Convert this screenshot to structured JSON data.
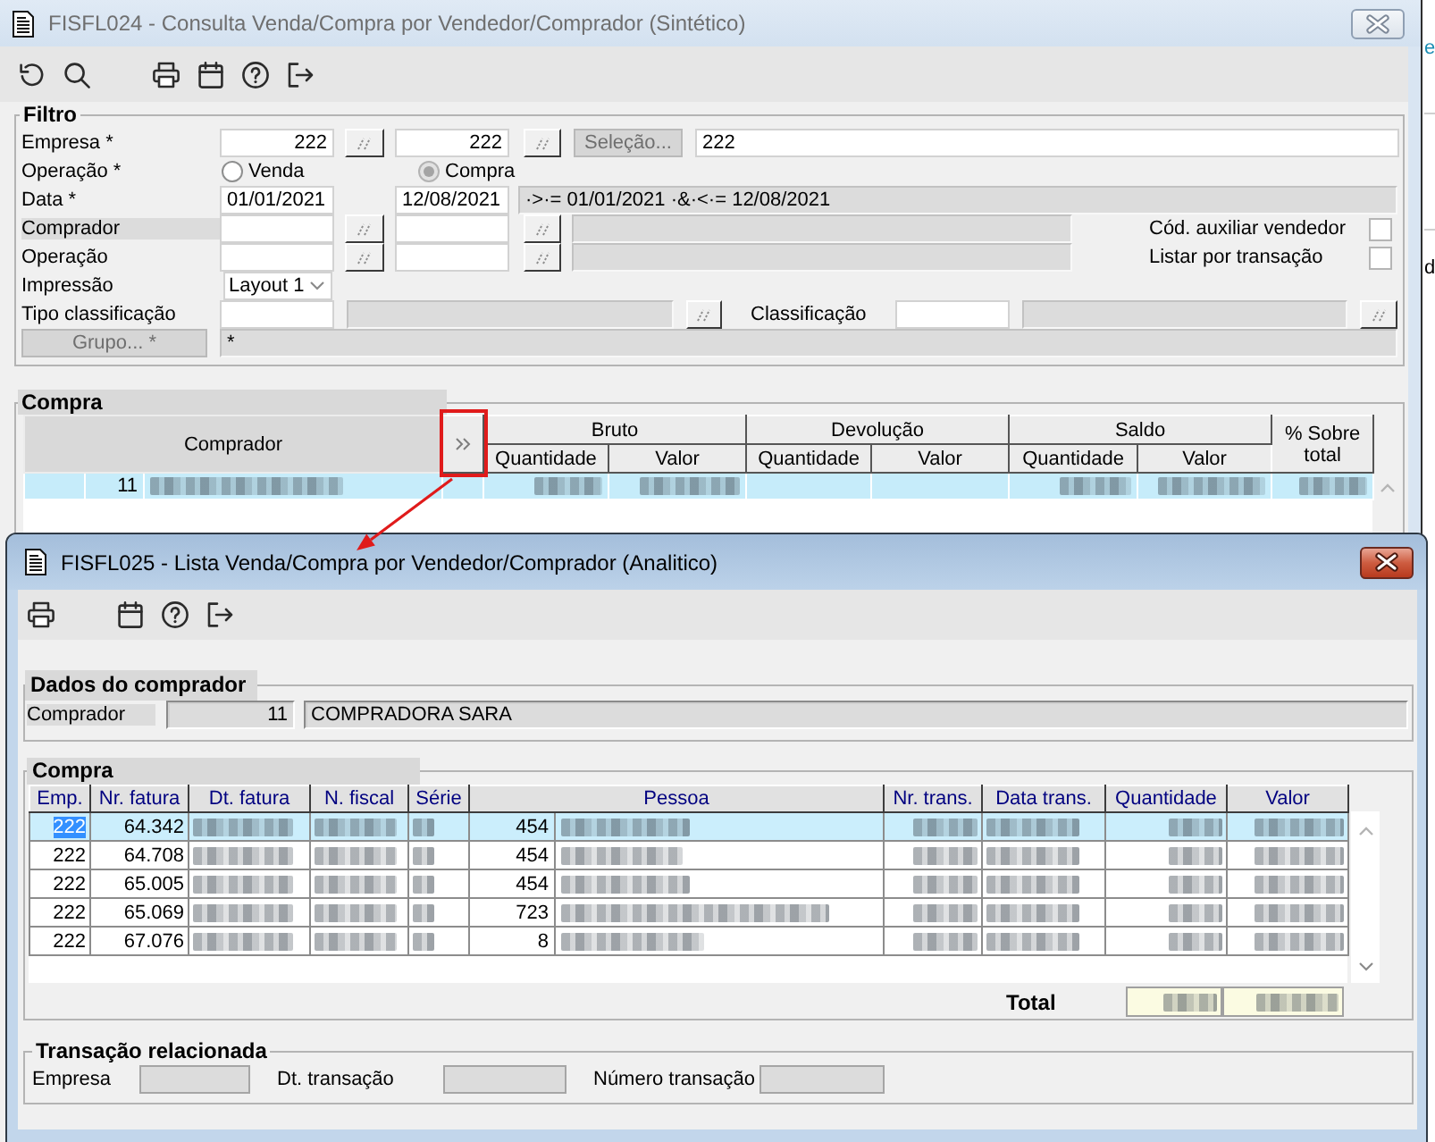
{
  "window": {
    "title": "FISFL024 - Consulta Venda/Compra por Vendedor/Comprador (Sintético)",
    "active": false
  },
  "filter": {
    "legend": "Filtro",
    "company": {
      "label": "Empresa *",
      "from": "222",
      "to": "222",
      "selection_button": {
        "label": "Seleção...",
        "disabled": true
      },
      "selection": "222"
    },
    "operation_type": {
      "label": "Operação *",
      "options": [
        {
          "label": "Venda",
          "selected": false
        },
        {
          "label": "Compra",
          "selected": true
        }
      ]
    },
    "date": {
      "label": "Data *",
      "from": "01/01/2021",
      "to": "12/08/2021",
      "expression": "·>·= 01/01/2021 ·&·<·= 12/08/2021"
    },
    "buyer": {
      "label": "Comprador",
      "highlighted": true
    },
    "operation": {
      "label": "Operação",
      "highlighted": false
    },
    "options": [
      {
        "label": "Cód. auxiliar vendedor",
        "checked": false
      },
      {
        "label": "Listar por transação",
        "checked": false
      }
    ],
    "print_layout": {
      "label": "Impressão",
      "value": "Layout 1"
    },
    "classification_type": {
      "label": "Tipo classificação"
    },
    "classification": {
      "label": "Classificação"
    },
    "group": {
      "button": {
        "label": "Grupo... *",
        "disabled": true
      },
      "value": "*"
    }
  },
  "summary": {
    "legend": "Compra",
    "columns": [
      {
        "kind": "label",
        "label": "Comprador",
        "highlighted": true
      },
      {
        "kind": "expand",
        "annotated": true
      },
      {
        "kind": "group",
        "label": "Bruto",
        "sub": [
          "Quantidade",
          "Valor"
        ]
      },
      {
        "kind": "group",
        "label": "Devolução",
        "sub": [
          "Quantidade",
          "Valor"
        ]
      },
      {
        "kind": "group",
        "label": "Saldo",
        "sub": [
          "Quantidade",
          "Valor"
        ]
      },
      {
        "kind": "label",
        "label": "% Sobre total",
        "highlighted": false
      }
    ],
    "rows": [
      {
        "selected": true,
        "cells": [
          {
            "kind": "coded",
            "code": "11"
          },
          {
            "kind": "empty"
          },
          {
            "kind": "blurred"
          },
          {
            "kind": "blurred"
          },
          {
            "kind": "empty"
          },
          {
            "kind": "empty"
          },
          {
            "kind": "blurred"
          },
          {
            "kind": "blurred"
          },
          {
            "kind": "blurred"
          }
        ]
      }
    ]
  },
  "detail_window": {
    "title": "FISFL025 - Lista Venda/Compra por Vendedor/Comprador (Analitico)",
    "active": true,
    "buyer": {
      "legend": "Dados do comprador",
      "label": "Comprador",
      "highlighted": true,
      "code": "11",
      "name": "COMPRADORA SARA"
    },
    "purchases": {
      "legend": "Compra",
      "columns": [
        {
          "label": "Emp."
        },
        {
          "label": "Nr. fatura"
        },
        {
          "label": "Dt. fatura"
        },
        {
          "label": "N. fiscal"
        },
        {
          "label": "Série"
        },
        {
          "label": "Pessoa"
        },
        {
          "label": "Nr. trans."
        },
        {
          "label": "Data trans."
        },
        {
          "label": "Quantidade"
        },
        {
          "label": "Valor"
        }
      ],
      "rows": [
        {
          "selected": true,
          "cells": [
            {
              "kind": "text",
              "text": "222",
              "focused": true
            },
            {
              "kind": "text",
              "text": "64.342",
              "focused": false
            },
            {
              "kind": "blurred",
              "focused": false
            },
            {
              "kind": "blurred",
              "focused": false
            },
            {
              "kind": "blurred",
              "focused": false
            },
            {
              "kind": "coded",
              "code": "454",
              "focused": false
            },
            {
              "kind": "blurred",
              "focused": false
            },
            {
              "kind": "blurred",
              "focused": false
            },
            {
              "kind": "blurred",
              "focused": false
            },
            {
              "kind": "blurred",
              "focused": false
            }
          ]
        },
        {
          "selected": false,
          "cells": [
            {
              "kind": "text",
              "text": "222",
              "focused": false
            },
            {
              "kind": "text",
              "text": "64.708",
              "focused": false
            },
            {
              "kind": "blurred",
              "focused": false
            },
            {
              "kind": "blurred",
              "focused": false
            },
            {
              "kind": "blurred",
              "focused": false
            },
            {
              "kind": "coded",
              "code": "454",
              "focused": false
            },
            {
              "kind": "blurred",
              "focused": false
            },
            {
              "kind": "blurred",
              "focused": false
            },
            {
              "kind": "blurred",
              "focused": false
            },
            {
              "kind": "blurred",
              "focused": false
            }
          ]
        },
        {
          "selected": false,
          "cells": [
            {
              "kind": "text",
              "text": "222",
              "focused": false
            },
            {
              "kind": "text",
              "text": "65.005",
              "focused": false
            },
            {
              "kind": "blurred",
              "focused": false
            },
            {
              "kind": "blurred",
              "focused": false
            },
            {
              "kind": "blurred",
              "focused": false
            },
            {
              "kind": "coded",
              "code": "454",
              "focused": false
            },
            {
              "kind": "blurred",
              "focused": false
            },
            {
              "kind": "blurred",
              "focused": false
            },
            {
              "kind": "blurred",
              "focused": false
            },
            {
              "kind": "blurred",
              "focused": false
            }
          ]
        },
        {
          "selected": false,
          "cells": [
            {
              "kind": "text",
              "text": "222",
              "focused": false
            },
            {
              "kind": "text",
              "text": "65.069",
              "focused": false
            },
            {
              "kind": "blurred",
              "focused": false
            },
            {
              "kind": "blurred",
              "focused": false
            },
            {
              "kind": "blurred",
              "focused": false
            },
            {
              "kind": "coded",
              "code": "723",
              "focused": false
            },
            {
              "kind": "blurred",
              "focused": false
            },
            {
              "kind": "blurred",
              "focused": false
            },
            {
              "kind": "blurred",
              "focused": false
            },
            {
              "kind": "blurred",
              "focused": false
            }
          ]
        },
        {
          "selected": false,
          "cells": [
            {
              "kind": "text",
              "text": "222",
              "focused": false
            },
            {
              "kind": "text",
              "text": "67.076",
              "focused": false
            },
            {
              "kind": "blurred",
              "focused": false
            },
            {
              "kind": "blurred",
              "focused": false
            },
            {
              "kind": "blurred",
              "focused": false
            },
            {
              "kind": "coded",
              "code": "8",
              "focused": false
            },
            {
              "kind": "blurred",
              "focused": false
            },
            {
              "kind": "blurred",
              "focused": false
            },
            {
              "kind": "blurred",
              "focused": false
            },
            {
              "kind": "blurred",
              "focused": false
            }
          ]
        }
      ]
    },
    "total": {
      "label": "Total",
      "values": [
        {
          "kind": "blurred"
        },
        {
          "kind": "blurred"
        }
      ]
    },
    "related": {
      "legend": "Transação relacionada",
      "fields": [
        {
          "label": "Empresa"
        },
        {
          "label": "Dt. transação"
        },
        {
          "label": "Número transação"
        }
      ]
    }
  },
  "background_app": {
    "texts": [
      {
        "kind": "link",
        "text": "e"
      },
      {
        "kind": "text",
        "text": "d"
      }
    ]
  }
}
